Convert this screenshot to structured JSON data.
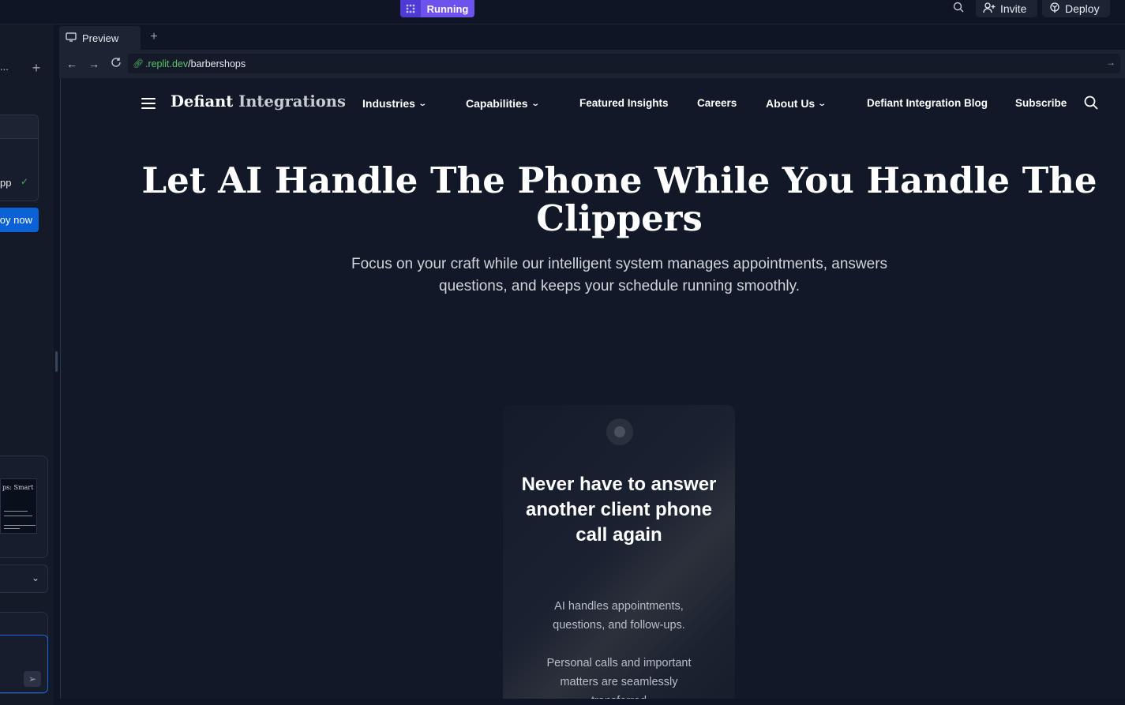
{
  "topbar": {
    "run_label": "Running",
    "invite_label": "Invite",
    "deploy_label": "Deploy",
    "accent_color": "#6e52ee"
  },
  "left_panel": {
    "ellipsis": "...",
    "card_text": "pp",
    "deploy_button": "oy now",
    "thumb_title": "ps: Smart"
  },
  "preview": {
    "tab_label": "Preview",
    "url_host": ".replit.dev",
    "url_path": "/barbershops"
  },
  "site": {
    "brand_part1": "Defiant",
    "brand_part2": "Integrations",
    "nav": {
      "industries": "Industries",
      "capabilities": "Capabilities",
      "featured": "Featured Insights",
      "careers": "Careers",
      "about": "About Us",
      "blog": "Defiant Integration Blog",
      "subscribe": "Subscribe"
    },
    "hero_title": "Let AI Handle The Phone While You Handle The Clippers",
    "hero_subtitle": "Focus on your craft while our intelligent system manages appointments, answers questions, and keeps your schedule running smoothly.",
    "phone": {
      "title": "Never have to answer another client phone call again",
      "para1": "AI handles appointments, questions, and follow-ups.",
      "para2": "Personal calls and important matters are seamlessly transferred"
    }
  }
}
